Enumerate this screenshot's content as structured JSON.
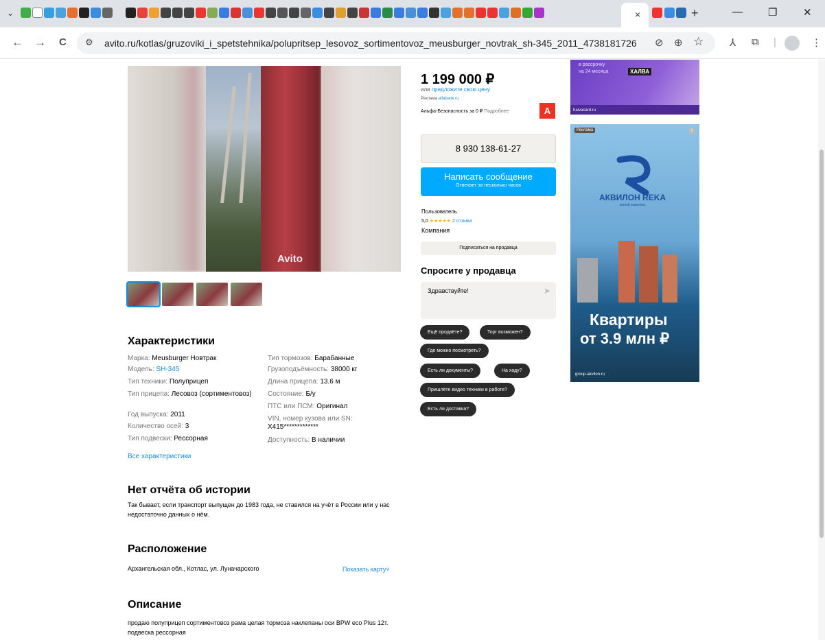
{
  "browser": {
    "url": "avito.ru/kotlas/gruzoviki_i_spetstehnika/polupritsep_lesovoz_sortimentovoz_meusburger_novtrak_sh-345_2011_4738181726",
    "tab_close": "×",
    "new_tab": "+",
    "icons": {
      "back": "←",
      "forward": "→",
      "reload": "C",
      "site_info": "⚙",
      "star": "☆",
      "zoom": "🔍"
    }
  },
  "listing": {
    "price": "1 199 000 ₽",
    "offer_prefix": "или",
    "offer_link": "предложите свою цену",
    "ad_line": "Реклама",
    "ad_domain": "alfabank.ru",
    "insurance_text": "Альфа-Безопасность за 0 ₽",
    "insurance_more": "Подробнее",
    "alfa_logo": "А",
    "phone": "8 930 138-61-27",
    "message_button": "Написать сообщение",
    "message_sub": "Отвечает за несколько часов",
    "seller_name": "Пользователь",
    "seller_rating": "5,0",
    "seller_stars": "★★★★★",
    "seller_reviews": "2 отзыва",
    "seller_type": "Компания",
    "subscribe_button": "Подписаться на продавца",
    "ask_title": "Спросите у продавца",
    "ask_input": "Здравствуйте!",
    "ask_send": "➤",
    "chips": [
      "Ещё продаёте?",
      "Торг возможен?",
      "Где можно посмотреть?",
      "Есть ли документы?",
      "На ходу?",
      "Пришлёте видео техники в работе?",
      "Есть ли доставка?"
    ],
    "watermark": "Avito"
  },
  "specs": {
    "title": "Характеристики",
    "left": [
      {
        "k": "Марка:",
        "v": "Meusburger Новтрак"
      },
      {
        "k": "Модель:",
        "v": "SH-345"
      },
      {
        "k": "Тип техники:",
        "v": "Полуприцеп"
      },
      {
        "k": "Тип прицепа:",
        "v": "Лесовоз (сортиментовоз)"
      },
      {
        "k": "Год выпуска:",
        "v": "2011"
      },
      {
        "k": "Количество осей:",
        "v": "3"
      },
      {
        "k": "Тип подвески:",
        "v": "Рессорная"
      }
    ],
    "right": [
      {
        "k": "Тип тормозов:",
        "v": "Барабанные"
      },
      {
        "k": "Грузоподъёмность:",
        "v": "38000 кг"
      },
      {
        "k": "Длина прицепа:",
        "v": "13.6 м"
      },
      {
        "k": "Состояние:",
        "v": "Б/у"
      },
      {
        "k": "ПТС или ПСМ:",
        "v": "Оригинал"
      },
      {
        "k": "VIN, номер кузова или SN:",
        "v": "X415*************"
      },
      {
        "k": "Доступность:",
        "v": "В наличии"
      }
    ],
    "all_link": "Все характеристики"
  },
  "history": {
    "title": "Нет отчёта об истории",
    "text": "Так бывает, если транспорт выпущен до 1983 года, не ставился на учёт в России или у нас недостаточно данных о нём."
  },
  "location": {
    "title": "Расположение",
    "address": "Архангельская обл., Котлас, ул. Луначарского",
    "map_link": "Показать карту˅"
  },
  "description": {
    "title": "Описание",
    "text": "продаю полуприцеп сортиментовоз рама целая тормоза наклепаны оси BPW eco Plus 12т. подвеска рессорная"
  },
  "ads": {
    "top_lines": [
      "в рассрочку",
      "на 24 месяца"
    ],
    "top_brand": "ХАЛВА",
    "top_footer": "halvacard.ru",
    "main_label": "Реклама",
    "main_info": "i",
    "main_brand": "АКВИЛОН REKA",
    "main_sub": "жилой комплекс",
    "main_headline_1": "Квартиры",
    "main_headline_2": "от 3.9 млн ₽",
    "main_footer": "group-akvilon.ru"
  }
}
